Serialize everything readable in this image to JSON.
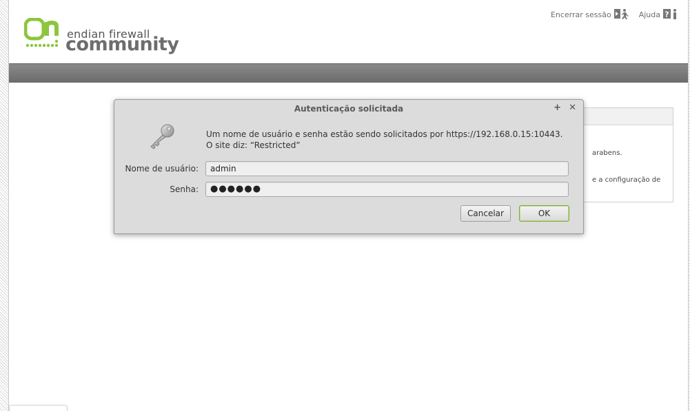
{
  "header": {
    "logo_line1": "endian firewall",
    "logo_line2": "community",
    "logout_label": "Encerrar sessão",
    "help_label": "Ajuda",
    "logout_icon": "logout-icon",
    "help_icon": "help-icon"
  },
  "background": {
    "partial_text_1": "arabens.",
    "partial_text_2": "e a configuração de"
  },
  "dialog": {
    "title": "Autenticação solicitada",
    "maximize_symbol": "+",
    "close_symbol": "✕",
    "message_line1": "Um nome de usuário e senha estão sendo solicitados por https://192.168.0.15:10443.",
    "message_line2": "O site diz: “Restricted”",
    "username_label": "Nome de usuário:",
    "username_value": "admin",
    "password_label": "Senha:",
    "password_value": "●●●●●●",
    "cancel_label": "Cancelar",
    "ok_label": "OK",
    "icon": "key-icon"
  },
  "colors": {
    "brand_green": "#8cc63e",
    "header_bar": "#737373",
    "ok_focus": "#7fae3c"
  }
}
